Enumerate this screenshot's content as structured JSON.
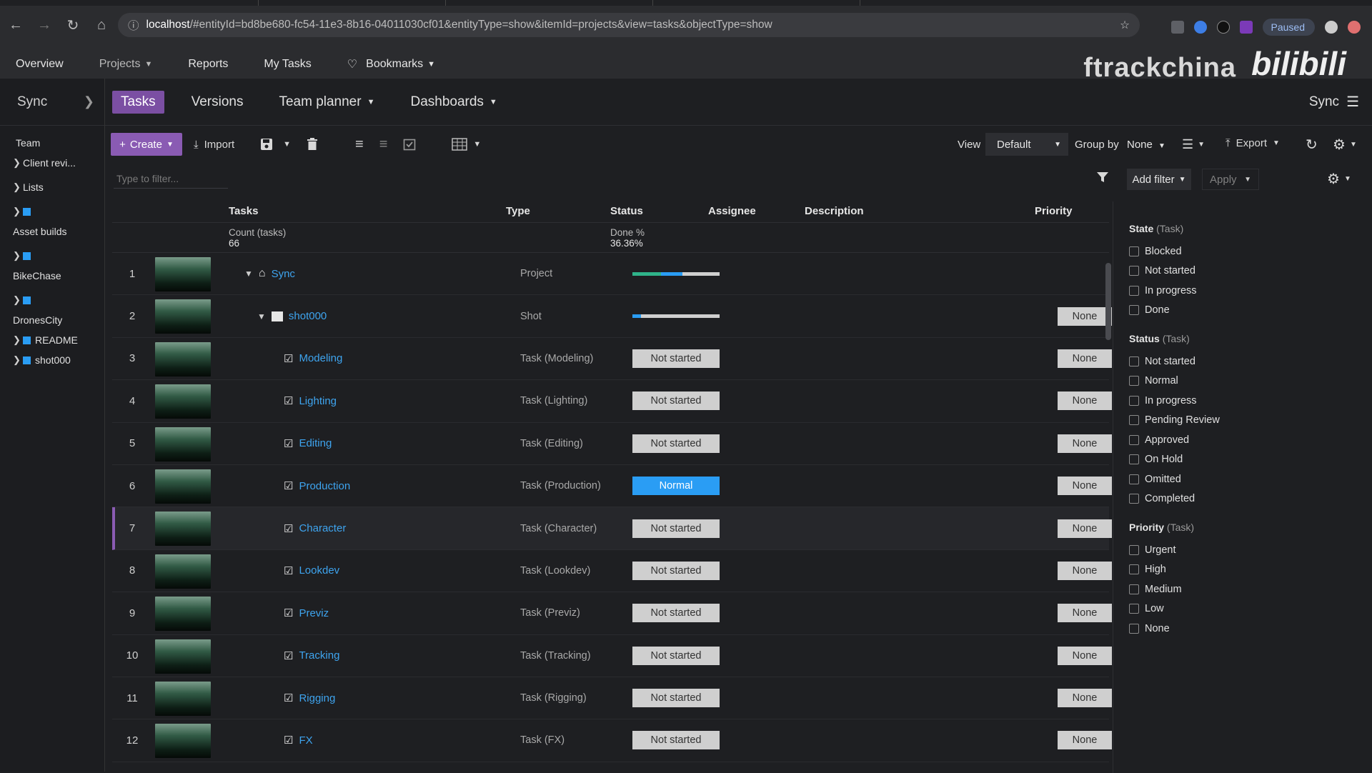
{
  "browser": {
    "url_host": "localhost",
    "url_rest": "/#entityId=bd8be680-fc54-11e3-8b16-04011030cf01&entityType=show&itemId=projects&view=tasks&objectType=show",
    "paused_label": "Paused"
  },
  "watermark": {
    "ftrack": "ftrackchina",
    "bili": "bilibili"
  },
  "appnav": {
    "overview": "Overview",
    "projects": "Projects",
    "reports": "Reports",
    "my_tasks": "My Tasks",
    "bookmarks": "Bookmarks"
  },
  "leftpanel": {
    "title": "Sync",
    "items": [
      {
        "label": "Team"
      },
      {
        "label": "Client revi..."
      },
      {
        "label": "Lists"
      },
      {
        "label": ""
      },
      {
        "label": "Asset builds"
      },
      {
        "label": ""
      },
      {
        "label": "BikeChase"
      },
      {
        "label": ""
      },
      {
        "label": "DronesCity"
      },
      {
        "label": "README"
      },
      {
        "label": "shot000"
      }
    ]
  },
  "tabs": {
    "tasks": "Tasks",
    "versions": "Versions",
    "team_planner": "Team planner",
    "dashboards": "Dashboards",
    "sync": "Sync"
  },
  "toolbar": {
    "create": "Create",
    "import": "Import",
    "view_label": "View",
    "view_value": "Default",
    "group_by_label": "Group by",
    "group_by_value": "None",
    "export": "Export"
  },
  "filterbar": {
    "placeholder": "Type to filter...",
    "add_filter": "Add filter",
    "apply": "Apply"
  },
  "grid": {
    "columns": {
      "tasks": "Tasks",
      "type": "Type",
      "status": "Status",
      "assignee": "Assignee",
      "description": "Description",
      "priority": "Priority"
    },
    "summary": {
      "count_label": "Count (tasks)",
      "count_value": "66",
      "done_label": "Done %",
      "done_value": "36.36%"
    },
    "rows": [
      {
        "num": "1",
        "name": "Sync",
        "type": "Project",
        "status": "",
        "priority": ""
      },
      {
        "num": "2",
        "name": "shot000",
        "type": "Shot",
        "status": "",
        "priority": "None"
      },
      {
        "num": "3",
        "name": "Modeling",
        "type": "Task (Modeling)",
        "status": "Not started",
        "priority": "None"
      },
      {
        "num": "4",
        "name": "Lighting",
        "type": "Task (Lighting)",
        "status": "Not started",
        "priority": "None"
      },
      {
        "num": "5",
        "name": "Editing",
        "type": "Task (Editing)",
        "status": "Not started",
        "priority": "None"
      },
      {
        "num": "6",
        "name": "Production",
        "type": "Task (Production)",
        "status": "Normal",
        "priority": "None"
      },
      {
        "num": "7",
        "name": "Character",
        "type": "Task (Character)",
        "status": "Not started",
        "priority": "None"
      },
      {
        "num": "8",
        "name": "Lookdev",
        "type": "Task (Lookdev)",
        "status": "Not started",
        "priority": "None"
      },
      {
        "num": "9",
        "name": "Previz",
        "type": "Task (Previz)",
        "status": "Not started",
        "priority": "None"
      },
      {
        "num": "10",
        "name": "Tracking",
        "type": "Task (Tracking)",
        "status": "Not started",
        "priority": "None"
      },
      {
        "num": "11",
        "name": "Rigging",
        "type": "Task (Rigging)",
        "status": "Not started",
        "priority": "None"
      },
      {
        "num": "12",
        "name": "FX",
        "type": "Task (FX)",
        "status": "Not started",
        "priority": "None"
      }
    ]
  },
  "filters": {
    "state": {
      "title": "State",
      "suffix": "(Task)",
      "options": [
        "Blocked",
        "Not started",
        "In progress",
        "Done"
      ]
    },
    "status": {
      "title": "Status",
      "suffix": "(Task)",
      "options": [
        "Not started",
        "Normal",
        "In progress",
        "Pending Review",
        "Approved",
        "On Hold",
        "Omitted",
        "Completed"
      ]
    },
    "priority": {
      "title": "Priority",
      "suffix": "(Task)",
      "options": [
        "Urgent",
        "High",
        "Medium",
        "Low",
        "None"
      ]
    }
  },
  "colors": {
    "accent": "#8a5bb3",
    "link": "#3ea4ef",
    "status_normal": "#2a9df4"
  }
}
